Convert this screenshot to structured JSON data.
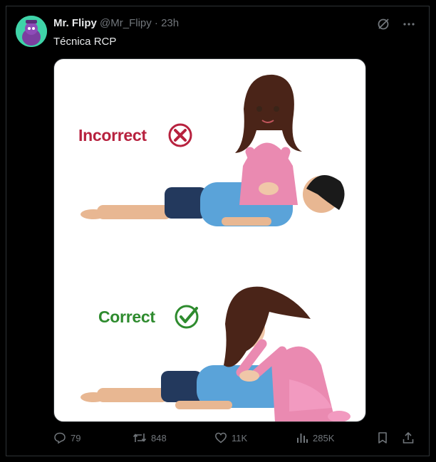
{
  "tweet": {
    "author_name": "Mr. Flipy",
    "author_handle": "@Mr_Flipy",
    "separator": "·",
    "time": "23h",
    "text": "Técnica RCP"
  },
  "media": {
    "incorrect_label": "Incorrect",
    "correct_label": "Correct",
    "colors": {
      "incorrect": "#b7213e",
      "correct": "#2e8b2e"
    }
  },
  "actions": {
    "replies": "79",
    "retweets": "848",
    "likes": "11K",
    "views": "285K"
  },
  "icons": [
    "grok-icon",
    "more-icon",
    "reply-icon",
    "retweet-icon",
    "like-icon",
    "views-icon",
    "bookmark-icon",
    "share-icon"
  ]
}
